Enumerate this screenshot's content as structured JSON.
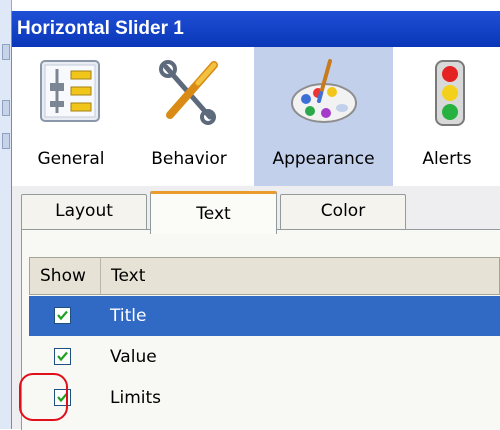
{
  "window": {
    "title": "Horizontal Slider 1"
  },
  "toolbar": {
    "items": [
      {
        "label": "General",
        "icon": "general-layout-icon",
        "selected": false
      },
      {
        "label": "Behavior",
        "icon": "tools-icon",
        "selected": false
      },
      {
        "label": "Appearance",
        "icon": "palette-icon",
        "selected": true
      },
      {
        "label": "Alerts",
        "icon": "traffic-light-icon",
        "selected": false
      }
    ]
  },
  "tabs": [
    {
      "label": "Layout",
      "active": false
    },
    {
      "label": "Text",
      "active": true
    },
    {
      "label": "Color",
      "active": false
    }
  ],
  "grid": {
    "headers": {
      "show": "Show",
      "text": "Text"
    },
    "rows": [
      {
        "text": "Title",
        "checked": true,
        "selected": true
      },
      {
        "text": "Value",
        "checked": true,
        "selected": false
      },
      {
        "text": "Limits",
        "checked": true,
        "selected": false,
        "highlighted": true
      }
    ]
  },
  "colors": {
    "titlebar": "#0a37b8",
    "selection": "#316ac5",
    "active_tab_accent": "#e99b2c",
    "annotation": "#e0101a"
  }
}
